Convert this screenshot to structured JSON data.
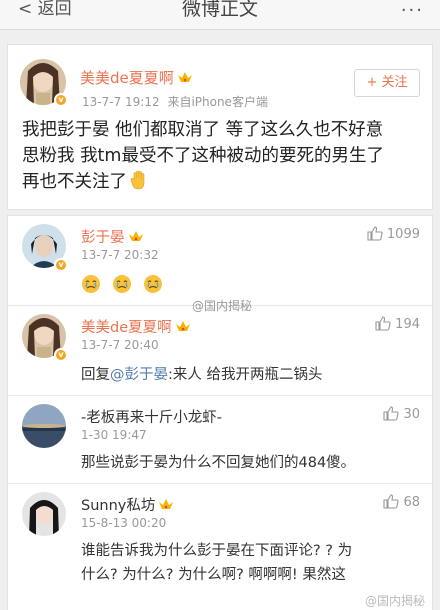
{
  "nav": {
    "back_label": "返回",
    "title": "微博正文",
    "more_label": "···"
  },
  "post": {
    "author": "美美de夏夏啊",
    "time": "13-7-7 19:12",
    "source": "来自iPhone客户端",
    "follow_label": "+ 关注",
    "text_line1": "我把彭于晏 他们都取消了 等了这么久也不好意",
    "text_line2": "思粉我 我tm最受不了这种被动的要死的男生了",
    "text_line3": "再也不关注了"
  },
  "comments": [
    {
      "author": "彭于晏",
      "time": "13-7-7 20:32",
      "likes": "1099",
      "text": ""
    },
    {
      "author": "美美de夏夏啊",
      "time": "13-7-7 20:40",
      "likes": "194",
      "reply_prefix": "回复",
      "mention": "@彭于晏",
      "text": ":来人 给我开两瓶二锅头"
    },
    {
      "author": "-老板再来十斤小龙虾-",
      "time": "1-30 19:47",
      "likes": "30",
      "text": "那些说彭于晏为什么不回复她们的484傻。"
    },
    {
      "author": "Sunny私坊",
      "time": "15-8-13 00:20",
      "likes": "68",
      "text_line1": "谁能告诉我为什么彭于晏在下面评论? ? 为",
      "text_line2": "什么? 为什么? 为什么啊? 啊啊啊! 果然这"
    }
  ],
  "watermarks": {
    "middle": "@国内揭秘",
    "bottom": "@国内揭秘"
  },
  "colors": {
    "accent_orange": "#eb7350",
    "link_blue": "#507daf",
    "meta_gray": "#999999"
  }
}
